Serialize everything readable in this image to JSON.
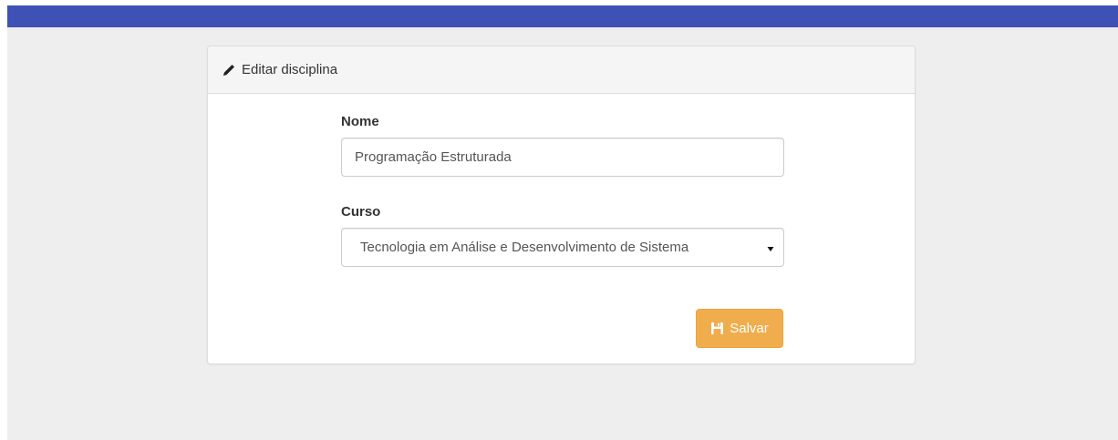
{
  "colors": {
    "topbar": "#3f51b5",
    "background": "#eeeeee",
    "button": "#f0ad4e"
  },
  "panel": {
    "title": "Editar disciplina",
    "title_icon": "pencil-icon"
  },
  "form": {
    "nome_label": "Nome",
    "nome_value": "Programação Estruturada",
    "curso_label": "Curso",
    "curso_selected": "Tecnologia em Análise e Desenvolvimento de Sistema"
  },
  "buttons": {
    "save_label": "Salvar",
    "save_icon": "floppy-disk-icon"
  }
}
